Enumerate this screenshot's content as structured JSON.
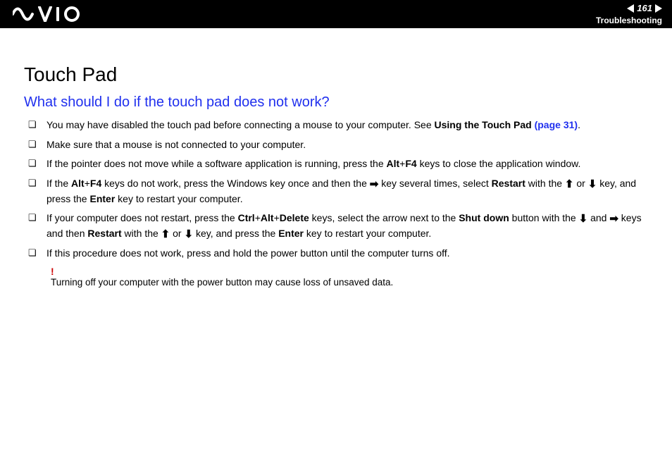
{
  "header": {
    "page_number": "161",
    "section": "Troubleshooting"
  },
  "title": "Touch Pad",
  "question": "What should I do if the touch pad does not work?",
  "bullets": {
    "b1_a": "You may have disabled the touch pad before connecting a mouse to your computer. See ",
    "b1_b": "Using the Touch Pad ",
    "b1_c": "(page 31)",
    "b1_d": ".",
    "b2": "Make sure that a mouse is not connected to your computer.",
    "b3_a": "If the pointer does not move while a software application is running, press the ",
    "b3_b": "Alt",
    "b3_c": "+",
    "b3_d": "F4",
    "b3_e": " keys to close the application window.",
    "b4_a": "If the ",
    "b4_b": "Alt",
    "b4_c": "+",
    "b4_d": "F4",
    "b4_e": " keys do not work, press the Windows key once and then the ",
    "b4_f": " key several times, select ",
    "b4_g": "Restart",
    "b4_h": " with the ",
    "b4_i": " or ",
    "b4_j": " key, and press the ",
    "b4_k": "Enter",
    "b4_l": " key to restart your computer.",
    "b5_a": "If your computer does not restart, press the ",
    "b5_b": "Ctrl",
    "b5_c": "+",
    "b5_d": "Alt",
    "b5_e": "+",
    "b5_f": "Delete",
    "b5_g": " keys, select the arrow next to the ",
    "b5_h": "Shut down",
    "b5_i": " button with the ",
    "b5_j": " and ",
    "b5_k": " keys and then ",
    "b5_l": "Restart",
    "b5_m": " with the ",
    "b5_n": " or ",
    "b5_o": " key, and press the ",
    "b5_p": "Enter",
    "b5_q": " key to restart your computer.",
    "b6": "If this procedure does not work, press and hold the power button until the computer turns off."
  },
  "note": {
    "mark": "!",
    "text": "Turning off your computer with the power button may cause loss of unsaved data."
  }
}
